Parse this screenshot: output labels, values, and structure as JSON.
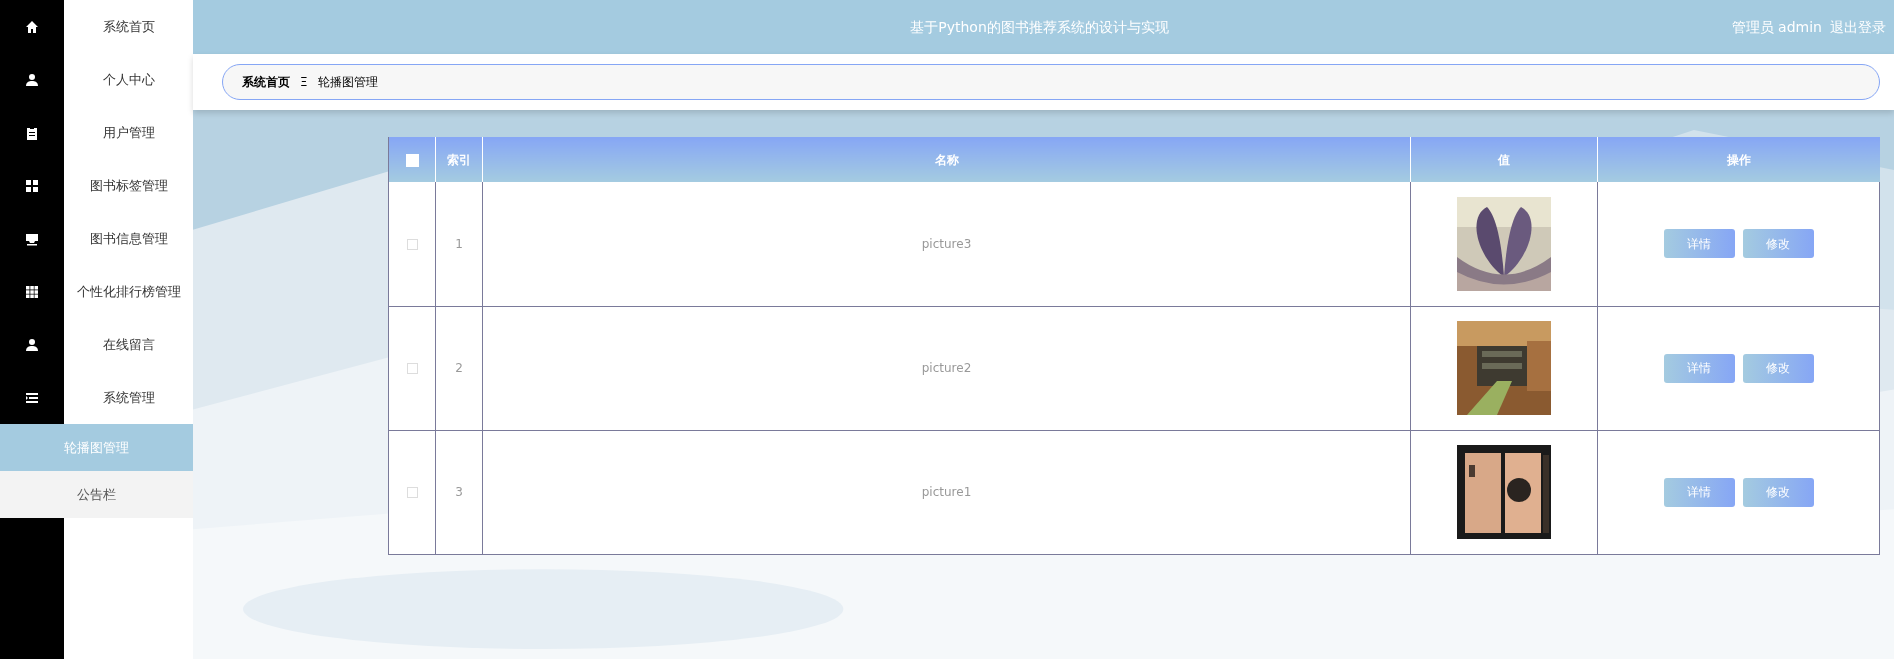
{
  "sidebar": {
    "items": [
      {
        "label": "系统首页",
        "selected": false
      },
      {
        "label": "个人中心",
        "selected": false
      },
      {
        "label": "用户管理",
        "selected": false
      },
      {
        "label": "图书标签管理",
        "selected": false
      },
      {
        "label": "图书信息管理",
        "selected": false
      },
      {
        "label": "个性化排行榜管理",
        "selected": false
      },
      {
        "label": "在线留言",
        "selected": false
      },
      {
        "label": "系统管理",
        "selected": false,
        "expanded": true,
        "children": [
          {
            "label": "轮播图管理",
            "selected": true
          },
          {
            "label": "公告栏",
            "selected": false
          }
        ]
      }
    ]
  },
  "header": {
    "title": "基于Python的图书推荐系统的设计与实现",
    "user": "管理员 admin",
    "logout": "退出登录"
  },
  "breadcrumb": {
    "items": [
      "系统首页",
      "轮播图管理"
    ],
    "separator": "Ξ"
  },
  "table": {
    "columns": [
      "索引",
      "名称",
      "值",
      "操作"
    ],
    "select_all": {
      "checked": false
    },
    "rows": [
      {
        "checked": false,
        "index": "1",
        "name": "picture3",
        "value": {
          "kind": "picture"
        },
        "actions": [
          "详情",
          "修改"
        ]
      },
      {
        "checked": false,
        "index": "2",
        "name": "picture2",
        "value": {
          "kind": "picture"
        },
        "actions": [
          "详情",
          "修改"
        ]
      },
      {
        "checked": false,
        "index": "3",
        "name": "picture1",
        "value": {
          "kind": "picture"
        },
        "actions": [
          "详情",
          "修改"
        ]
      }
    ]
  }
}
